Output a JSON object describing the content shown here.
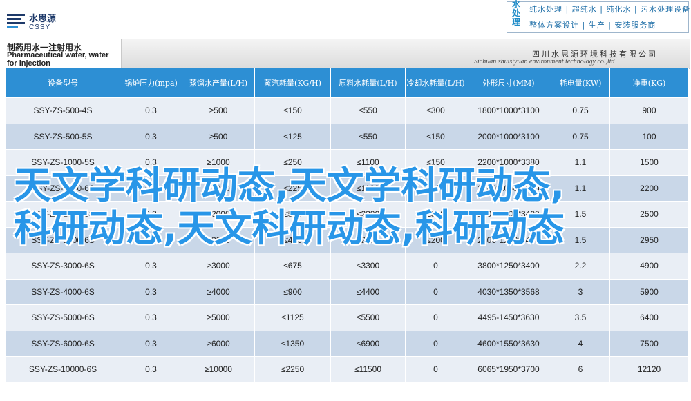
{
  "header": {
    "logo_cn": "水思源",
    "logo_en": "CSSY",
    "slogan_vertical": "水处理",
    "slogan_line1": "纯水处理 | 超纯水 | 纯化水 | 污水处理设备",
    "slogan_line2": "整体方案设计 | 生产 | 安装服务商",
    "title_cn": "制药用水一注射用水",
    "title_en": "Pharmaceutical water, water for injection",
    "company_cn": "四川水思源环境科技有限公司",
    "company_en": "Sichuan shuisiyuan environment technology co.,ltd"
  },
  "table": {
    "columns": [
      "设备型号",
      "锅炉压力(mpa)",
      "蒸馏水产量(L/H)",
      "蒸汽耗量(KG/H)",
      "原料水耗量(L/H)",
      "冷却水耗量(L/H)",
      "外形尺寸(MM)",
      "耗电量(KW)",
      "净重(KG)"
    ],
    "rows": [
      [
        "SSY-ZS-500-4S",
        "0.3",
        "≥500",
        "≤150",
        "≤550",
        "≤300",
        "1800*1000*3100",
        "0.75",
        "900"
      ],
      [
        "SSY-ZS-500-5S",
        "0.3",
        "≥500",
        "≤125",
        "≤550",
        "≤150",
        "2000*1000*3100",
        "0.75",
        "100"
      ],
      [
        "SSY-ZS-1000-5S",
        "0.3",
        "≥1000",
        "≤250",
        "≤1100",
        "≤150",
        "2200*1000*3380",
        "1.1",
        "1500"
      ],
      [
        "SSY-ZS-1000-6S",
        "0.3",
        "≥1000",
        "≤225",
        "≤1100",
        "≤100",
        "2200*1000*3380",
        "1.1",
        "2200"
      ],
      [
        "SSY-ZS-2000-5S",
        "0.3",
        "≥2000",
        "≤500",
        "≤2200",
        "≤300",
        "2600*1200*3400",
        "1.5",
        "2500"
      ],
      [
        "SSY-ZS-2000-6S",
        "0.3",
        "≥2000",
        "≤450",
        "≤2200",
        "≤200",
        "2600*1200*3400",
        "1.5",
        "2950"
      ],
      [
        "SSY-ZS-3000-6S",
        "0.3",
        "≥3000",
        "≤675",
        "≤3300",
        "0",
        "3800*1250*3400",
        "2.2",
        "4900"
      ],
      [
        "SSY-ZS-4000-6S",
        "0.3",
        "≥4000",
        "≤900",
        "≤4400",
        "0",
        "4030*1350*3568",
        "3",
        "5900"
      ],
      [
        "SSY-ZS-5000-6S",
        "0.3",
        "≥5000",
        "≤1125",
        "≤5500",
        "0",
        "4495-1450*3630",
        "3.5",
        "6400"
      ],
      [
        "SSY-ZS-6000-6S",
        "0.3",
        "≥6000",
        "≤1350",
        "≤6900",
        "0",
        "4600*1550*3630",
        "4",
        "7500"
      ],
      [
        "SSY-ZS-10000-6S",
        "0.3",
        "≥10000",
        "≤2250",
        "≤11500",
        "0",
        "6065*1950*3700",
        "6",
        "12120"
      ]
    ]
  },
  "overlay": {
    "line1": "天文学科研动态,天文学科研动态,",
    "line2": "科研动态,天文科研动态,科研动态"
  }
}
